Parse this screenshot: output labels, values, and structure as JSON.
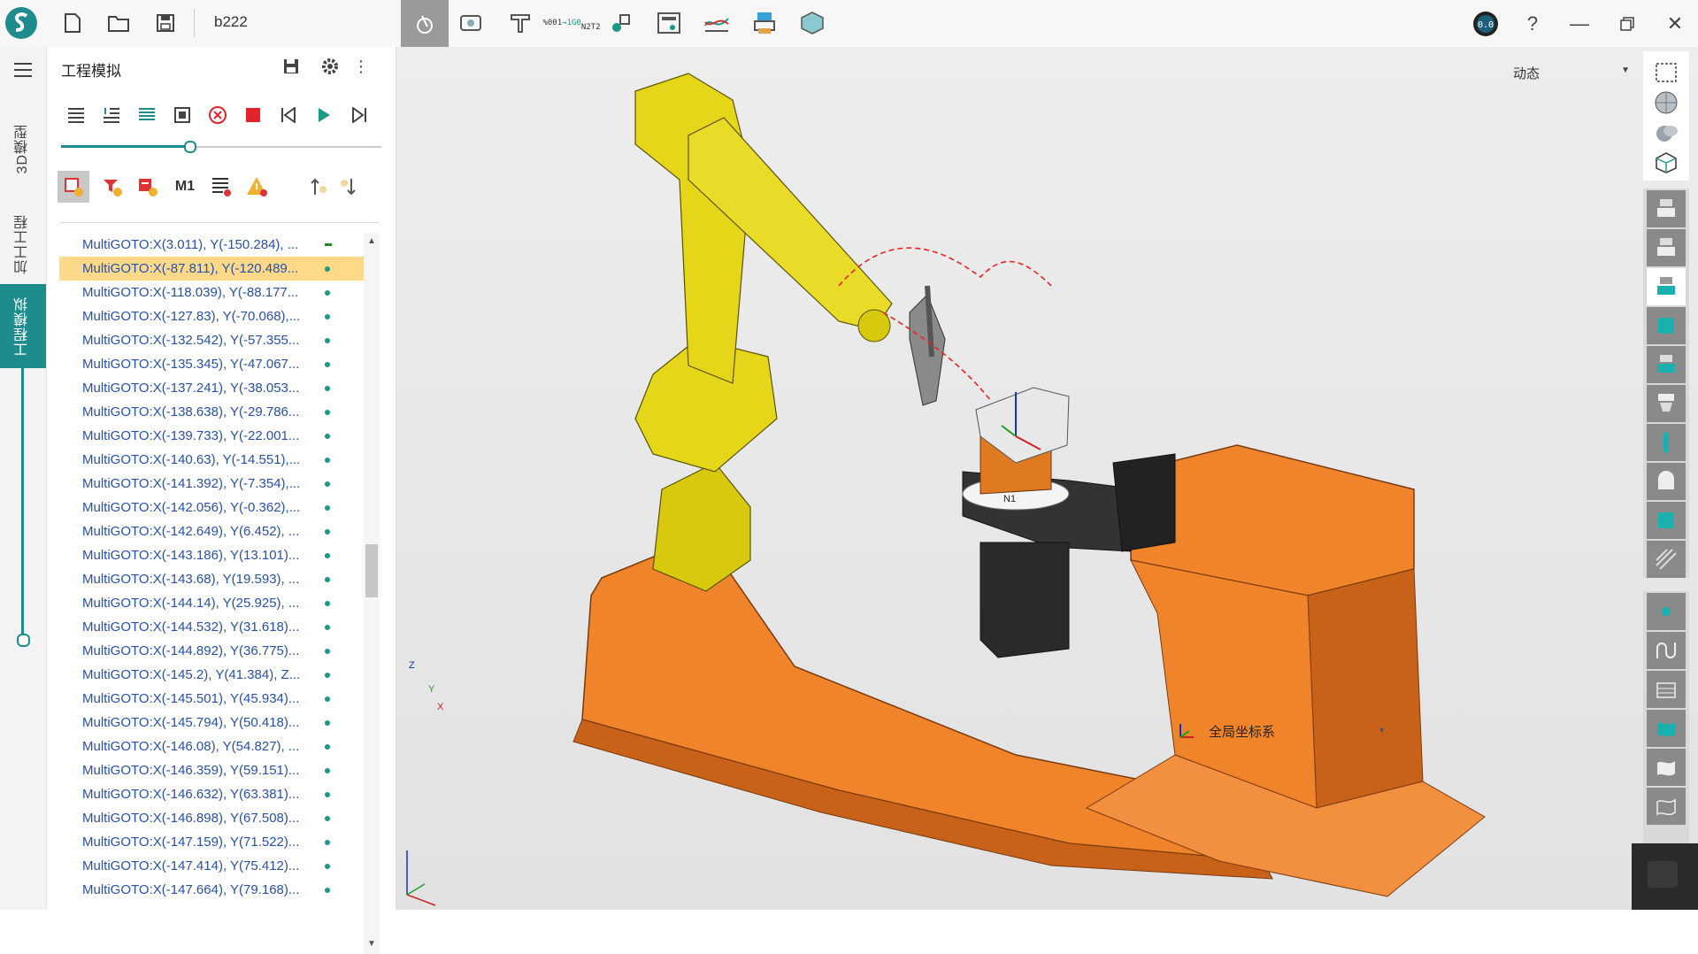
{
  "app": {
    "file_name": "b222"
  },
  "left_tabs": [
    "3D模型",
    "加工工程",
    "工程模拟"
  ],
  "panel": {
    "title": "工程模拟"
  },
  "list": [
    {
      "text": "MultiGOTO:X(3.011), Y(-150.284), ...",
      "marker": "dash"
    },
    {
      "text": "MultiGOTO:X(-87.811), Y(-120.489...",
      "marker": "dot",
      "selected": true
    },
    {
      "text": "MultiGOTO:X(-118.039), Y(-88.177...",
      "marker": "dot"
    },
    {
      "text": "MultiGOTO:X(-127.83), Y(-70.068),...",
      "marker": "dot"
    },
    {
      "text": "MultiGOTO:X(-132.542), Y(-57.355...",
      "marker": "dot"
    },
    {
      "text": "MultiGOTO:X(-135.345), Y(-47.067...",
      "marker": "dot"
    },
    {
      "text": "MultiGOTO:X(-137.241), Y(-38.053...",
      "marker": "dot"
    },
    {
      "text": "MultiGOTO:X(-138.638), Y(-29.786...",
      "marker": "dot"
    },
    {
      "text": "MultiGOTO:X(-139.733), Y(-22.001...",
      "marker": "dot"
    },
    {
      "text": "MultiGOTO:X(-140.63), Y(-14.551),...",
      "marker": "dot"
    },
    {
      "text": "MultiGOTO:X(-141.392), Y(-7.354),...",
      "marker": "dot"
    },
    {
      "text": "MultiGOTO:X(-142.056), Y(-0.362),...",
      "marker": "dot"
    },
    {
      "text": "MultiGOTO:X(-142.649), Y(6.452), ...",
      "marker": "dot"
    },
    {
      "text": "MultiGOTO:X(-143.186), Y(13.101)...",
      "marker": "dot"
    },
    {
      "text": "MultiGOTO:X(-143.68), Y(19.593), ...",
      "marker": "dot"
    },
    {
      "text": "MultiGOTO:X(-144.14), Y(25.925), ...",
      "marker": "dot"
    },
    {
      "text": "MultiGOTO:X(-144.532), Y(31.618)...",
      "marker": "dot"
    },
    {
      "text": "MultiGOTO:X(-144.892), Y(36.775)...",
      "marker": "dot"
    },
    {
      "text": "MultiGOTO:X(-145.2), Y(41.384), Z...",
      "marker": "dot"
    },
    {
      "text": "MultiGOTO:X(-145.501), Y(45.934)...",
      "marker": "dot"
    },
    {
      "text": "MultiGOTO:X(-145.794), Y(50.418)...",
      "marker": "dot"
    },
    {
      "text": "MultiGOTO:X(-146.08), Y(54.827), ...",
      "marker": "dot"
    },
    {
      "text": "MultiGOTO:X(-146.359), Y(59.151)...",
      "marker": "dot"
    },
    {
      "text": "MultiGOTO:X(-146.632), Y(63.381)...",
      "marker": "dot"
    },
    {
      "text": "MultiGOTO:X(-146.898), Y(67.508)...",
      "marker": "dot"
    },
    {
      "text": "MultiGOTO:X(-147.159), Y(71.522)...",
      "marker": "dot"
    },
    {
      "text": "MultiGOTO:X(-147.414), Y(75.412)...",
      "marker": "dot"
    },
    {
      "text": "MultiGOTO:X(-147.664), Y(79.168)...",
      "marker": "dot"
    }
  ],
  "progress": {
    "value_fraction": 0.4
  },
  "side_slider": {
    "value_fraction": 0.05
  },
  "viewport": {
    "view_mode": "动态",
    "coord_system": "全局坐标系",
    "axis_z": "Z",
    "axis_y": "Y",
    "axis_x": "X",
    "node_label": "N1"
  },
  "top_icons": [
    "app-logo-icon",
    "new-file-icon",
    "open-folder-icon",
    "save-icon",
    "select-tool-icon",
    "measure-icon",
    "fixture-icon",
    "nc-code-icon",
    "sim-icon",
    "calculator-icon",
    "chart-icon",
    "printer-icon",
    "package-icon"
  ],
  "colors": {
    "accent": "#1e8c8c",
    "selected_row": "#ffd98a",
    "link": "#2850a8",
    "robot": "#e0d21a",
    "base": "#f0842a"
  }
}
